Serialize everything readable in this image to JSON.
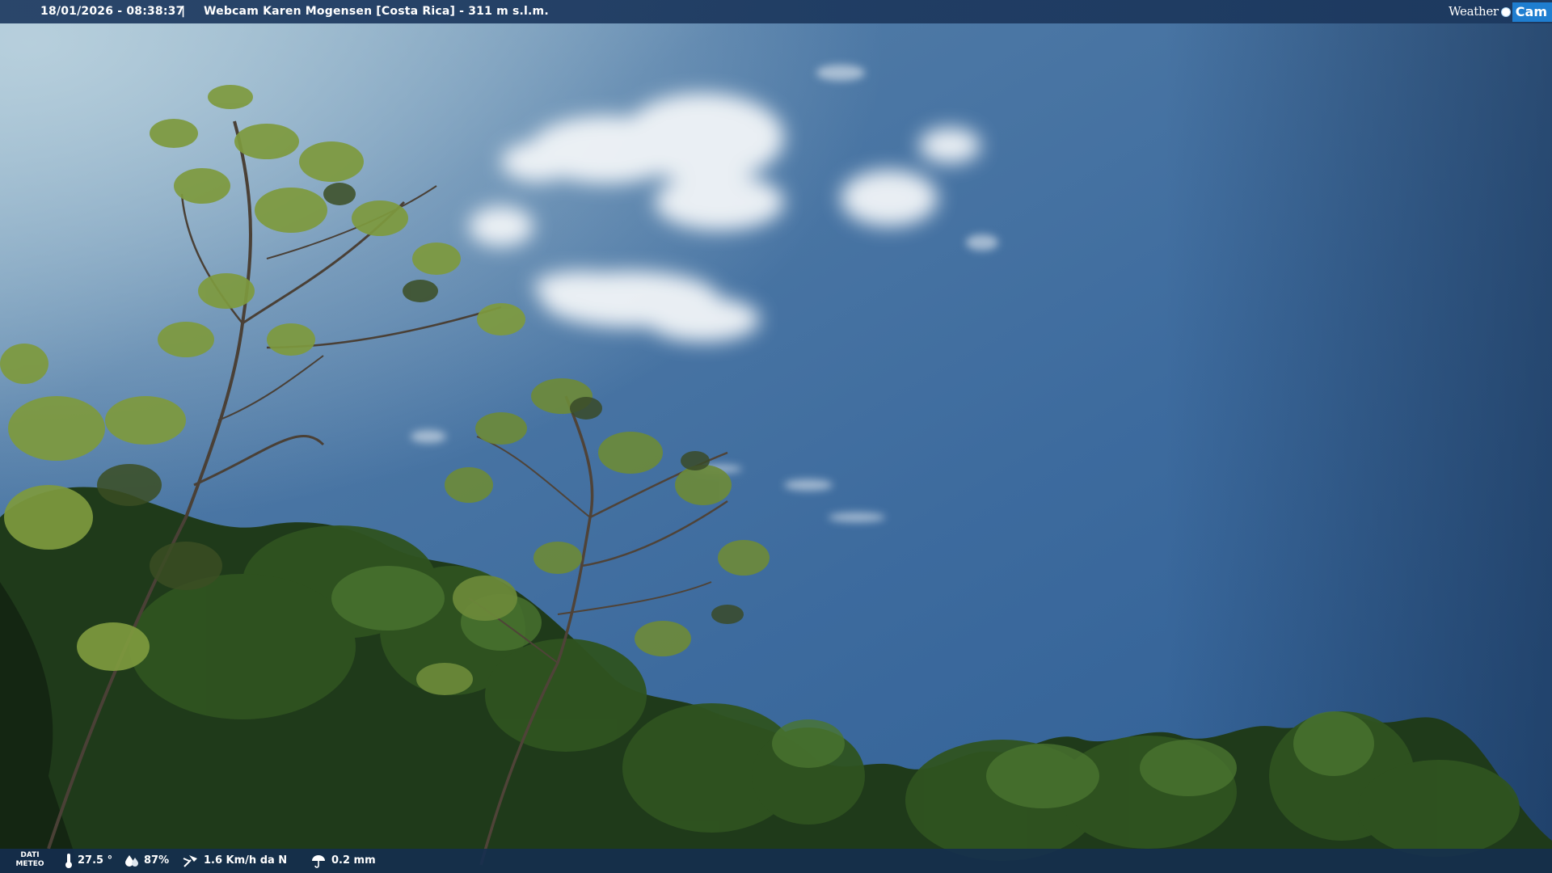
{
  "header": {
    "timestamp": "18/01/2026 - 08:38:37",
    "separator": "|",
    "title": "Webcam Karen Mogensen [Costa Rica] - 311 m s.l.m."
  },
  "logo": {
    "part1": "Weather",
    "part2": "Cam"
  },
  "footer": {
    "data_label_line1": "DATI",
    "data_label_line2": "METEO",
    "temperature": "27.5 °",
    "humidity": "87%",
    "wind": "1.6 Km/h da N",
    "rain": "0.2 mm"
  },
  "icons": [
    "thermometer-icon",
    "humidity-icon",
    "wind-icon",
    "rain-icon"
  ]
}
